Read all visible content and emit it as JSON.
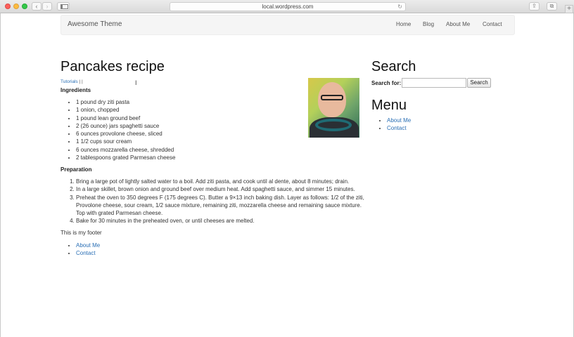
{
  "browser": {
    "url": "local.wordpress.com",
    "back_icon": "‹",
    "forward_icon": "›",
    "reload_icon": "↻",
    "share_icon": "⇪",
    "tabs_icon": "⧉",
    "newtab_icon": "+"
  },
  "navbar": {
    "brand": "Awesome Theme",
    "items": [
      {
        "label": "Home"
      },
      {
        "label": "Blog"
      },
      {
        "label": "About Me"
      },
      {
        "label": "Contact"
      }
    ]
  },
  "post": {
    "title": "Pancakes recipe",
    "category": "Tutorials",
    "category_suffix": "| |",
    "ingredients_heading": "Ingredients",
    "ingredients": [
      "1 pound dry ziti pasta",
      "1 onion, chopped",
      "1 pound lean ground beef",
      "2 (26 ounce) jars spaghetti sauce",
      "6 ounces provolone cheese, sliced",
      "1 1/2 cups sour cream",
      "6 ounces mozzarella cheese, shredded",
      "2 tablespoons grated Parmesan cheese"
    ],
    "preparation_heading": "Preparation",
    "steps": [
      "Bring a large pot of lightly salted water to a boil. Add ziti pasta, and cook until al dente, about 8 minutes; drain.",
      "In a large skillet, brown onion and ground beef over medium heat. Add spaghetti sauce, and simmer 15 minutes.",
      "Preheat the oven to 350 degrees F (175 degrees C). Butter a 9×13 inch baking dish. Layer as follows: 1/2 of the ziti, Provolone cheese, sour cream, 1/2 sauce mixture, remaining ziti, mozzarella cheese and remaining sauce mixture. Top with grated Parmesan cheese.",
      "Bake for 30 minutes in the preheated oven, or until cheeses are melted."
    ]
  },
  "footer": {
    "text": "This is my footer",
    "links": [
      {
        "label": "About Me"
      },
      {
        "label": "Contact"
      }
    ]
  },
  "sidebar": {
    "search_title": "Search",
    "search_label": "Search for:",
    "search_value": "",
    "search_button": "Search",
    "menu_title": "Menu",
    "menu_items": [
      {
        "label": "About Me"
      },
      {
        "label": "Contact"
      }
    ]
  },
  "colors": {
    "link": "#2a6fb5",
    "navbar_bg": "#f5f5f5"
  }
}
